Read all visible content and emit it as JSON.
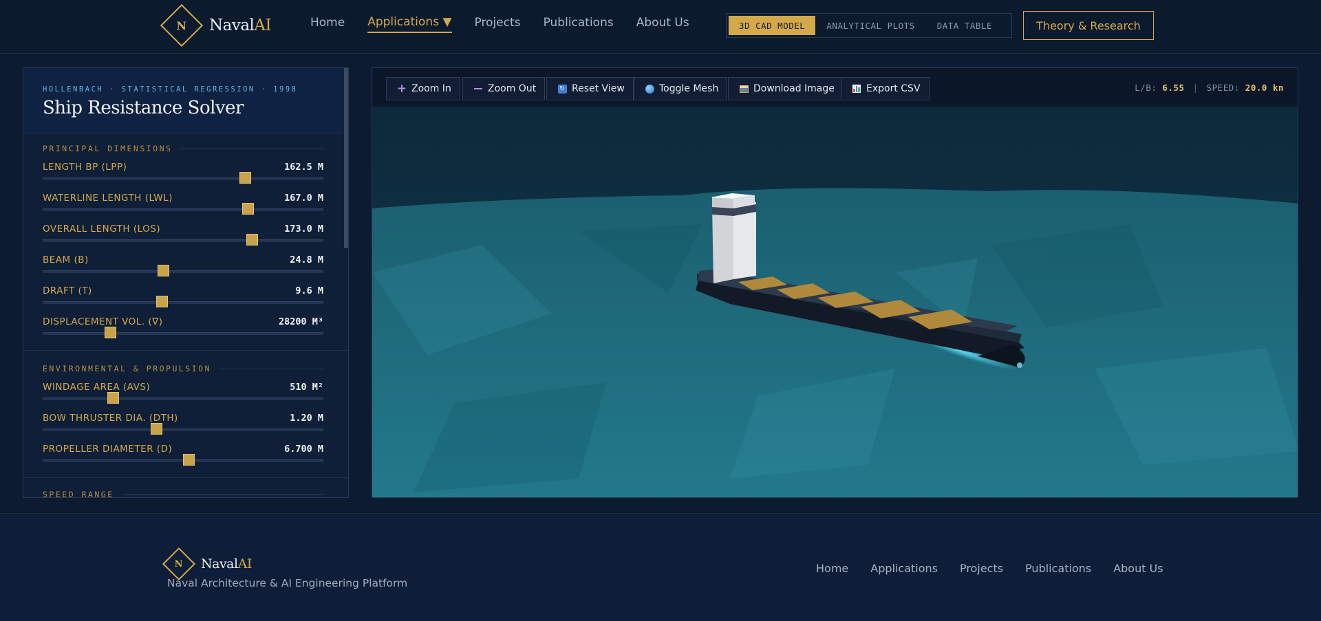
{
  "brand": {
    "letter": "N",
    "name": "Naval",
    "ai": "AI"
  },
  "nav": {
    "home": "Home",
    "applications": "Applications ▼",
    "projects": "Projects",
    "publications": "Publications",
    "about": "About Us"
  },
  "view_toggle": {
    "cad": "3D CAD MODEL",
    "plots": "ANALYTICAL PLOTS",
    "table": "DATA TABLE",
    "selected": "3D CAD MODEL"
  },
  "theory_button": "Theory & Research",
  "panel": {
    "tag": "HOLLENBACH · STATISTICAL REGRESSION · 1998",
    "title": "Ship Resistance Solver",
    "sections": {
      "principal": "PRINCIPAL DIMENSIONS",
      "environment": "ENVIRONMENTAL & PROPULSION",
      "speed": "SPEED RANGE"
    },
    "params": [
      {
        "label": "LENGTH BP (LPP)",
        "value": "162.5 M",
        "level": 0.72
      },
      {
        "label": "WATERLINE LENGTH (LWL)",
        "value": "167.0 M",
        "level": 0.73
      },
      {
        "label": "OVERALL LENGTH (LOS)",
        "value": "173.0 M",
        "level": 0.745
      },
      {
        "label": "BEAM (B)",
        "value": "24.8 M",
        "level": 0.43
      },
      {
        "label": "DRAFT (T)",
        "value": "9.6 M",
        "level": 0.425
      },
      {
        "label": "DISPLACEMENT VOL. (∇)",
        "value": "28200 M³",
        "level": 0.24
      },
      {
        "label": "WINDAGE AREA (AVS)",
        "value": "510 M²",
        "level": 0.25
      },
      {
        "label": "BOW THRUSTER DIA. (DTH)",
        "value": "1.20 M",
        "level": 0.405
      },
      {
        "label": "PROPELLER DIAMETER (D)",
        "value": "6.700 M",
        "level": 0.52
      }
    ]
  },
  "toolbar": {
    "zoom_in": "Zoom In",
    "zoom_out": "Zoom Out",
    "reset": "Reset View",
    "mesh": "Toggle Mesh",
    "download": "Download Image",
    "export": "Export CSV"
  },
  "readout": {
    "lb_label": "L/B:",
    "lb_value": "6.55",
    "sep": "|",
    "speed_label": "SPEED:",
    "speed_value": "20.0 kn"
  },
  "footer": {
    "tagline": "Naval Architecture & AI Engineering Platform",
    "nav": [
      "Home",
      "Applications",
      "Projects",
      "Publications",
      "About Us"
    ]
  },
  "colors": {
    "accent": "#d4a94a",
    "background": "#0d1b30",
    "sea": "#1e6f80",
    "info": "#5fb6e8"
  },
  "icons": {
    "zoom_in": "plus-icon",
    "zoom_out": "minus-icon",
    "reset": "reset-icon",
    "mesh": "globe-icon",
    "download": "image-icon",
    "export": "chart-icon"
  }
}
